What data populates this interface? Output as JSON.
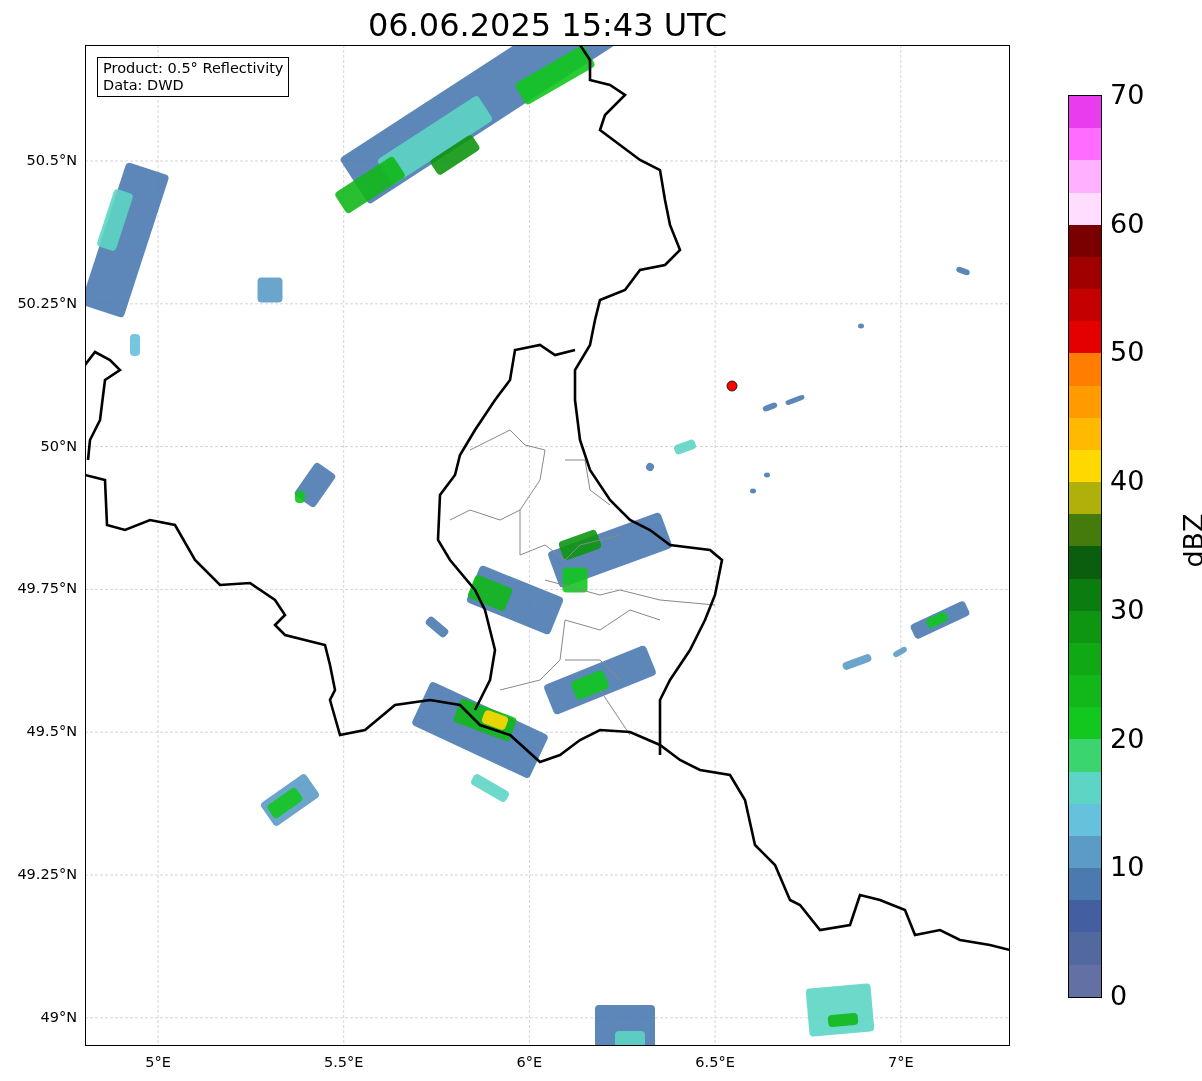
{
  "title": "06.06.2025 15:43 UTC",
  "map": {
    "info_box": [
      "Product: 0.5° Reflectivity",
      "Data: DWD"
    ],
    "y_ticks": [
      "50.5°N",
      "50.25°N",
      "50°N",
      "49.75°N",
      "49.5°N",
      "49.25°N",
      "49°N"
    ],
    "x_ticks": [
      "5°E",
      "5.5°E",
      "6°E",
      "6.5°E",
      "7°E"
    ]
  },
  "colorbar": {
    "label": "dBZ",
    "ticks": [
      "70",
      "60",
      "50",
      "40",
      "30",
      "20",
      "10",
      "0"
    ],
    "segments": [
      {
        "color": "#e83cee"
      },
      {
        "color": "#ff6cff"
      },
      {
        "color": "#ffb1ff"
      },
      {
        "color": "#ffddff"
      },
      {
        "color": "#7a0000"
      },
      {
        "color": "#a00000"
      },
      {
        "color": "#c40000"
      },
      {
        "color": "#e40000"
      },
      {
        "color": "#ff7d00"
      },
      {
        "color": "#ff9a00"
      },
      {
        "color": "#ffb900"
      },
      {
        "color": "#ffd800"
      },
      {
        "color": "#b0b00a"
      },
      {
        "color": "#457a0c"
      },
      {
        "color": "#0a5e0d"
      },
      {
        "color": "#0b7d10"
      },
      {
        "color": "#0e9612"
      },
      {
        "color": "#10a814"
      },
      {
        "color": "#12b81a"
      },
      {
        "color": "#12c71e"
      },
      {
        "color": "#3cd46e"
      },
      {
        "color": "#5dd5c4"
      },
      {
        "color": "#66c1dc"
      },
      {
        "color": "#5b9bc6"
      },
      {
        "color": "#4a7ab0"
      },
      {
        "color": "#445ea2"
      },
      {
        "color": "#52699f"
      },
      {
        "color": "#6370a3"
      }
    ]
  }
}
